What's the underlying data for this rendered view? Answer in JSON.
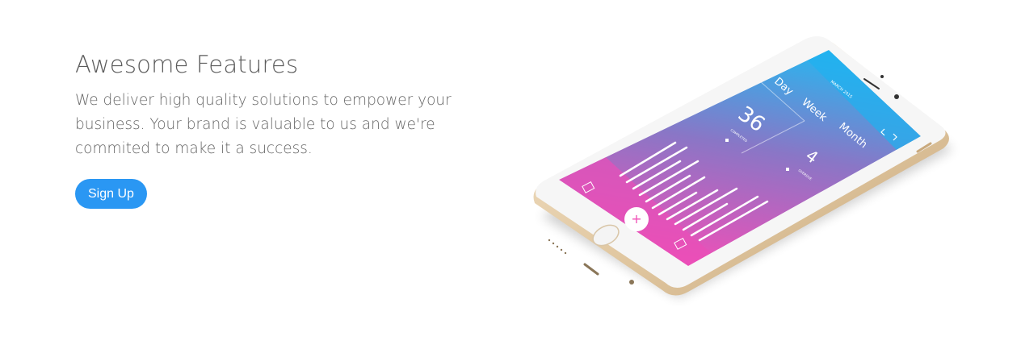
{
  "hero": {
    "title": "Awesome Features",
    "description": "We deliver high quality solutions to empower your business. Your brand is valuable to us and we're commited to make it a success.",
    "cta_label": "Sign Up"
  },
  "phone_app": {
    "header_date": "MARCH 2015",
    "tabs": [
      "Day",
      "Week",
      "Month"
    ],
    "stat_main_value": "36",
    "stat_main_label": "COMPLETED",
    "stat_secondary_value": "4",
    "stat_secondary_label": "OVERDUE",
    "add_label": "+"
  },
  "colors": {
    "accent": "#2a97f3",
    "screen_top": "#2bb4ee",
    "screen_bottom": "#f14fb7",
    "gold_frame": "#e2c9a3"
  }
}
